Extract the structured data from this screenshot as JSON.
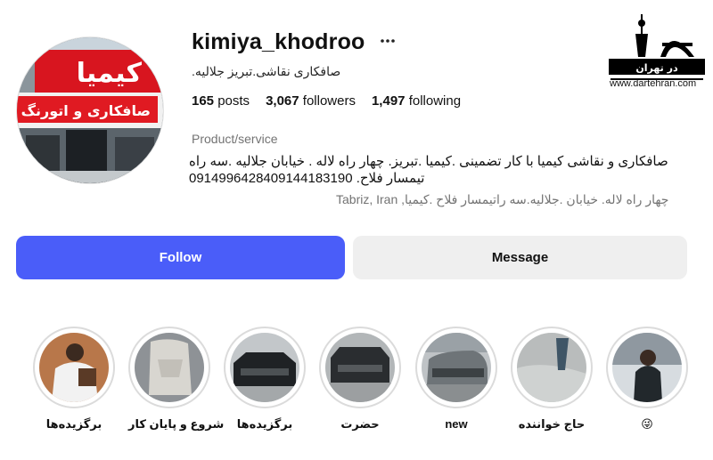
{
  "profile": {
    "username": "kimiya_khodroo",
    "more_icon": "more-horizontal-icon",
    "full_name": "صافکاری نقاشی.تبریز جلالیه.",
    "stats": {
      "posts": "165",
      "posts_label": "posts",
      "followers": "3,067",
      "followers_label": "followers",
      "following": "1,497",
      "following_label": "following"
    },
    "category": "Product/service",
    "bio": {
      "line1": "صافکاری و نقاشی کیمیا با کار تضمینی .کیمیا .تبریز. چهار راه لاله . خیابان جلالیه .سه راه",
      "line2": "تیمسار فلاح. 0914996428409144183190"
    },
    "address": "چهار راه لاله. خیابان .جلالیه.سه راتیمسار فلاح .کیمیا, Tabriz, Iran",
    "avatar_sign": {
      "line1": "کیمیا",
      "line2": "صافکاری و اتورنگ"
    }
  },
  "buttons": {
    "follow": "Follow",
    "message": "Message"
  },
  "watermark": {
    "logo_text": "در تهران",
    "url": "www.dartehran.com"
  },
  "highlights": [
    {
      "label": "😜"
    },
    {
      "label": "حاج خواننده"
    },
    {
      "label": "new"
    },
    {
      "label": "حضرت"
    },
    {
      "label": "برگزیده‌ها"
    },
    {
      "label": "شروع و پایان کار"
    },
    {
      "label": "برگزیده‌ها"
    }
  ],
  "colors": {
    "follow_button": "#4a5df9",
    "message_button": "#efefef",
    "sign_red": "#d8151f",
    "muted_text": "#737373"
  }
}
